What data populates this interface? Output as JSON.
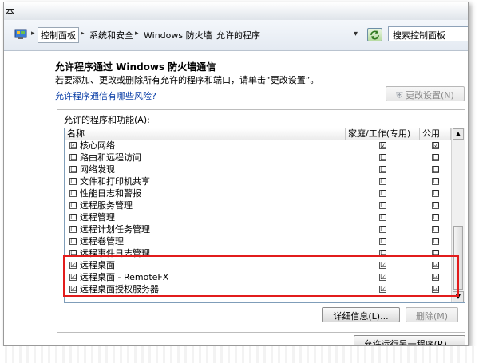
{
  "window": {
    "title_partial": "本"
  },
  "address_bar": {
    "crumbs": [
      "控制面板",
      "系统和安全",
      "Windows 防火墙",
      "允许的程序"
    ],
    "search_placeholder": "搜索控制面板"
  },
  "page": {
    "heading": "允许程序通过 Windows 防火墙通信",
    "description": "若要添加、更改或删除所有允许的程序和端口，请单击“更改设置”。",
    "risk_link": "允许程序通信有哪些风险?",
    "change_settings_button": "更改设置(N)",
    "group_label": "允许的程序和功能(A):",
    "columns": {
      "name": "名称",
      "home_work": "家庭/工作(专用)",
      "public": "公用"
    },
    "rows": [
      {
        "name": "核心网络",
        "enabled": "☑",
        "home": "☑",
        "public": "☑"
      },
      {
        "name": "路由和远程访问",
        "enabled": "☐",
        "home": "☐",
        "public": "☐"
      },
      {
        "name": "网络发现",
        "enabled": "☐",
        "home": "☐",
        "public": "☐"
      },
      {
        "name": "文件和打印机共享",
        "enabled": "☐",
        "home": "☐",
        "public": "☐"
      },
      {
        "name": "性能日志和警报",
        "enabled": "☐",
        "home": "☐",
        "public": "☐"
      },
      {
        "name": "远程服务管理",
        "enabled": "☐",
        "home": "☐",
        "public": "☐"
      },
      {
        "name": "远程管理",
        "enabled": "☐",
        "home": "☐",
        "public": "☐"
      },
      {
        "name": "远程计划任务管理",
        "enabled": "☐",
        "home": "☐",
        "public": "☐"
      },
      {
        "name": "远程卷管理",
        "enabled": "☐",
        "home": "☐",
        "public": "☐"
      },
      {
        "name": "远程事件日志管理",
        "enabled": "☐",
        "home": "☐",
        "public": "☐"
      },
      {
        "name": "远程桌面",
        "enabled": "☑",
        "home": "☑",
        "public": "☑"
      },
      {
        "name": "远程桌面 - RemoteFX",
        "enabled": "☑",
        "home": "☑",
        "public": "☑"
      },
      {
        "name": "远程桌面授权服务器",
        "enabled": "☑",
        "home": "☑",
        "public": "☑"
      }
    ],
    "details_button": "详细信息(L)...",
    "delete_button": "删除(M)",
    "allow_another_button": "允许运行另一程序(R)..."
  },
  "colors": {
    "highlight": "#e21c1c",
    "link": "#0b3fa7"
  }
}
